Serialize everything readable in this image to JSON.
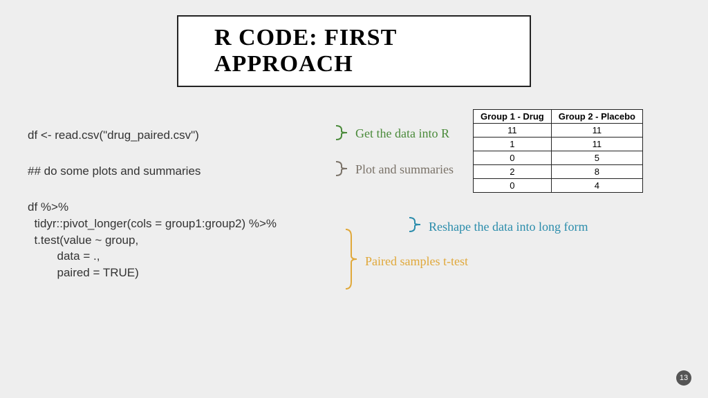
{
  "title": "R CODE: FIRST APPROACH",
  "code": {
    "line1": "df <- read.csv(\"drug_paired.csv\")",
    "line2": "## do some plots and summaries",
    "block": "df %>%\n  tidyr::pivot_longer(cols = group1:group2) %>%\n  t.test(value ~ group,\n         data = .,\n         paired = TRUE)"
  },
  "annotations": {
    "a1": "Get the data into R",
    "a2": "Plot and summaries",
    "a3": "Reshape the data into long form",
    "a4": "Paired samples t-test"
  },
  "table": {
    "headers": [
      "Group 1 - Drug",
      "Group 2 - Placebo"
    ],
    "rows": [
      [
        "11",
        "11"
      ],
      [
        "1",
        "11"
      ],
      [
        "0",
        "5"
      ],
      [
        "2",
        "8"
      ],
      [
        "0",
        "4"
      ]
    ]
  },
  "page_number": "13"
}
